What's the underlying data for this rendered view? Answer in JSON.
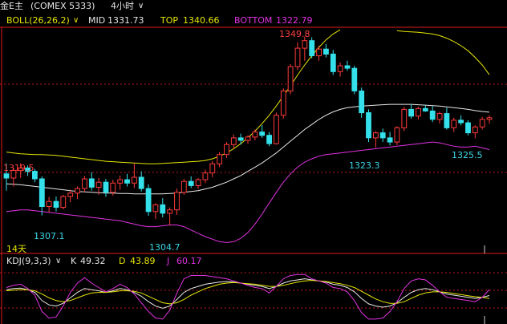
{
  "header": {
    "instrument": "金E主",
    "exchange": "(COMEX 5333)",
    "period": "4小时",
    "period_dropdown_icon": "chevron-down-icon"
  },
  "boll": {
    "name": "BOLL(26,26,2)",
    "mid_label": "MID",
    "mid_value": "1331.73",
    "top_label": "TOP",
    "top_value": "1340.66",
    "bottom_label": "BOTTOM",
    "bottom_value": "1322.79"
  },
  "annotations": {
    "high": "1349.8",
    "left_high": "1319.5",
    "low_1": "1307.1",
    "low_2": "1304.7",
    "low_3": "1323.3",
    "low_4": "1325.5",
    "time_span": "14天"
  },
  "kdj": {
    "name": "KDJ(9,3,3)",
    "k_label": "K",
    "k_value": "49.32",
    "d_label": "D",
    "d_value": "43.89",
    "j_label": "J",
    "j_value": "60.17"
  },
  "colors": {
    "up": "#ff3b3b",
    "down": "#34e1ea",
    "boll_mid": "#e8e8e8",
    "boll_top": "#e6e600",
    "boll_bottom": "#e233e2",
    "grid": "#ff2020"
  },
  "candles": [
    [
      1317.0,
      1319.5,
      1313.0,
      1316.0
    ],
    [
      1316.0,
      1318.5,
      1314.0,
      1317.8
    ],
    [
      1317.8,
      1319.5,
      1316.0,
      1318.4
    ],
    [
      1318.4,
      1319.0,
      1316.5,
      1317.6
    ],
    [
      1317.6,
      1318.2,
      1315.0,
      1315.8
    ],
    [
      1315.8,
      1316.4,
      1307.1,
      1309.2
    ],
    [
      1309.2,
      1311.5,
      1307.8,
      1310.4
    ],
    [
      1310.4,
      1311.6,
      1308.0,
      1309.0
    ],
    [
      1309.0,
      1312.0,
      1308.5,
      1311.6
    ],
    [
      1311.6,
      1313.2,
      1310.2,
      1312.4
    ],
    [
      1312.4,
      1314.0,
      1311.0,
      1313.5
    ],
    [
      1313.5,
      1316.5,
      1312.6,
      1315.8
    ],
    [
      1315.8,
      1317.4,
      1313.0,
      1313.8
    ],
    [
      1313.8,
      1316.0,
      1312.0,
      1315.0
    ],
    [
      1315.0,
      1315.8,
      1311.5,
      1312.6
    ],
    [
      1312.6,
      1315.6,
      1311.8,
      1314.8
    ],
    [
      1314.8,
      1316.6,
      1313.2,
      1315.6
    ],
    [
      1315.6,
      1317.0,
      1314.0,
      1314.8
    ],
    [
      1314.8,
      1319.5,
      1313.6,
      1316.2
    ],
    [
      1316.2,
      1317.6,
      1312.8,
      1313.5
    ],
    [
      1313.5,
      1314.5,
      1307.0,
      1308.0
    ],
    [
      1308.0,
      1310.0,
      1306.2,
      1309.6
    ],
    [
      1309.6,
      1311.2,
      1306.6,
      1307.6
    ],
    [
      1307.6,
      1309.0,
      1304.7,
      1308.4
    ],
    [
      1308.4,
      1313.5,
      1307.2,
      1312.6
    ],
    [
      1312.6,
      1315.8,
      1312.0,
      1315.2
    ],
    [
      1315.2,
      1316.4,
      1313.6,
      1314.2
    ],
    [
      1314.2,
      1316.0,
      1313.4,
      1315.6
    ],
    [
      1315.6,
      1318.0,
      1314.8,
      1317.2
    ],
    [
      1317.2,
      1320.0,
      1316.2,
      1319.4
    ],
    [
      1319.4,
      1322.2,
      1318.6,
      1321.6
    ],
    [
      1321.6,
      1324.6,
      1320.8,
      1324.0
    ],
    [
      1324.0,
      1326.4,
      1323.0,
      1325.6
    ],
    [
      1325.6,
      1326.6,
      1324.0,
      1325.0
    ],
    [
      1325.0,
      1326.2,
      1324.2,
      1325.8
    ],
    [
      1325.8,
      1327.6,
      1325.0,
      1327.0
    ],
    [
      1327.0,
      1328.6,
      1325.6,
      1326.2
    ],
    [
      1326.2,
      1327.0,
      1323.6,
      1324.2
    ],
    [
      1324.2,
      1331.6,
      1324.0,
      1331.0
    ],
    [
      1331.0,
      1337.4,
      1330.2,
      1336.8
    ],
    [
      1336.8,
      1343.2,
      1336.0,
      1342.6
    ],
    [
      1342.6,
      1348.4,
      1341.8,
      1347.0
    ],
    [
      1347.0,
      1349.8,
      1344.0,
      1348.8
    ],
    [
      1348.8,
      1349.6,
      1344.6,
      1345.2
    ],
    [
      1345.2,
      1347.6,
      1344.0,
      1346.8
    ],
    [
      1346.8,
      1348.0,
      1344.8,
      1345.6
    ],
    [
      1345.6,
      1346.6,
      1340.6,
      1341.4
    ],
    [
      1341.4,
      1343.6,
      1340.2,
      1342.8
    ],
    [
      1342.8,
      1344.0,
      1341.6,
      1342.2
    ],
    [
      1342.2,
      1342.8,
      1336.0,
      1336.8
    ],
    [
      1336.8,
      1337.6,
      1330.4,
      1331.6
    ],
    [
      1331.6,
      1332.4,
      1324.6,
      1325.6
    ],
    [
      1325.6,
      1327.2,
      1323.3,
      1326.8
    ],
    [
      1326.8,
      1327.8,
      1324.6,
      1325.6
    ],
    [
      1325.6,
      1327.0,
      1323.8,
      1324.6
    ],
    [
      1324.6,
      1328.4,
      1323.9,
      1328.0
    ],
    [
      1328.0,
      1333.0,
      1327.2,
      1332.4
    ],
    [
      1332.4,
      1333.6,
      1330.2,
      1330.8
    ],
    [
      1330.8,
      1333.0,
      1330.0,
      1332.6
    ],
    [
      1332.6,
      1333.4,
      1331.8,
      1332.0
    ],
    [
      1332.0,
      1333.2,
      1329.4,
      1330.0
    ],
    [
      1330.0,
      1331.8,
      1329.0,
      1331.4
    ],
    [
      1331.4,
      1332.8,
      1327.6,
      1328.0
    ],
    [
      1328.0,
      1330.4,
      1327.0,
      1329.8
    ],
    [
      1329.8,
      1331.0,
      1328.6,
      1329.2
    ],
    [
      1329.2,
      1329.8,
      1326.2,
      1326.8
    ],
    [
      1326.8,
      1328.6,
      1325.5,
      1328.2
    ],
    [
      1328.2,
      1330.6,
      1327.6,
      1330.0
    ],
    [
      1330.0,
      1331.0,
      1329.0,
      1330.4
    ]
  ],
  "boll_lines": {
    "top": [
      1322.2,
      1322.0,
      1321.8,
      1321.7,
      1321.6,
      1321.6,
      1321.5,
      1321.4,
      1321.2,
      1321.0,
      1320.8,
      1320.6,
      1320.4,
      1320.2,
      1320.0,
      1319.9,
      1319.8,
      1319.7,
      1319.6,
      1319.5,
      1319.4,
      1319.4,
      1319.5,
      1319.6,
      1319.7,
      1319.8,
      1319.9,
      1320.0,
      1320.2,
      1320.6,
      1321.2,
      1322.0,
      1323.0,
      1324.2,
      1325.6,
      1327.2,
      1329.0,
      1331.0,
      1333.2,
      1335.6,
      1338.0,
      1340.6,
      1343.0,
      1345.2,
      1347.2,
      1349.0,
      1350.4,
      1351.4,
      null,
      null,
      null,
      null,
      null,
      null,
      null,
      1351.2,
      1351.0,
      1350.9,
      1350.8,
      1350.6,
      1350.4,
      1350.0,
      1349.4,
      1348.6,
      1347.6,
      1346.4,
      1344.8,
      1343.0,
      1340.66
    ],
    "mid": [
      1314.6,
      1314.5,
      1314.4,
      1314.2,
      1314.0,
      1313.8,
      1313.6,
      1313.4,
      1313.2,
      1313.0,
      1312.8,
      1312.7,
      1312.6,
      1312.5,
      1312.4,
      1312.4,
      1312.3,
      1312.3,
      1312.2,
      1312.2,
      1312.2,
      1312.2,
      1312.2,
      1312.3,
      1312.4,
      1312.6,
      1312.8,
      1313.0,
      1313.4,
      1313.8,
      1314.4,
      1315.0,
      1315.8,
      1316.6,
      1317.6,
      1318.6,
      1319.6,
      1320.8,
      1322.0,
      1323.4,
      1324.8,
      1326.2,
      1327.6,
      1328.8,
      1330.0,
      1331.0,
      1331.8,
      1332.4,
      1332.8,
      1333.0,
      1333.2,
      1333.3,
      1333.4,
      1333.5,
      1333.6,
      1333.6,
      1333.6,
      1333.6,
      1333.5,
      1333.4,
      1333.3,
      1333.2,
      1333.0,
      1332.8,
      1332.6,
      1332.4,
      1332.1,
      1331.9,
      1331.73
    ],
    "bottom": [
      1308.0,
      1308.2,
      1308.4,
      1308.4,
      1308.2,
      1308.0,
      1307.8,
      1307.6,
      1307.4,
      1307.2,
      1307.0,
      1306.8,
      1306.6,
      1306.4,
      1306.2,
      1306.0,
      1305.8,
      1305.4,
      1305.0,
      1304.6,
      1304.4,
      1304.4,
      1304.6,
      1304.8,
      1304.8,
      1304.4,
      1303.6,
      1302.8,
      1302.0,
      1301.4,
      1300.8,
      1300.6,
      1300.8,
      1301.6,
      1303.0,
      1305.0,
      1307.4,
      1310.0,
      1312.6,
      1315.0,
      1317.0,
      1318.6,
      1319.8,
      1320.6,
      1321.2,
      1321.6,
      1321.8,
      1322.0,
      1322.2,
      1322.4,
      1322.6,
      1322.8,
      1323.0,
      1323.2,
      1323.4,
      1323.6,
      1323.8,
      1324.0,
      1324.2,
      1324.4,
      1324.6,
      1324.4,
      1324.0,
      1323.6,
      1323.4,
      1323.4,
      1323.6,
      1323.2,
      1322.79
    ]
  },
  "kdj_series": {
    "k": [
      60,
      62,
      63,
      60,
      55,
      40,
      32,
      30,
      35,
      45,
      55,
      62,
      60,
      58,
      55,
      58,
      62,
      60,
      55,
      48,
      38,
      30,
      26,
      30,
      42,
      55,
      62,
      66,
      70,
      72,
      74,
      75,
      74,
      72,
      70,
      68,
      66,
      62,
      66,
      72,
      76,
      78,
      80,
      78,
      76,
      74,
      70,
      68,
      64,
      56,
      44,
      34,
      30,
      28,
      30,
      36,
      46,
      55,
      60,
      62,
      60,
      56,
      52,
      50,
      48,
      46,
      44,
      46,
      49.32
    ],
    "d": [
      58,
      59,
      60,
      60,
      58,
      52,
      45,
      40,
      38,
      40,
      45,
      50,
      54,
      55,
      55,
      56,
      58,
      58,
      57,
      54,
      48,
      42,
      36,
      34,
      36,
      42,
      50,
      56,
      62,
      66,
      70,
      72,
      73,
      72,
      71,
      70,
      68,
      66,
      66,
      68,
      71,
      74,
      76,
      77,
      76,
      75,
      73,
      71,
      68,
      64,
      57,
      50,
      43,
      38,
      35,
      35,
      38,
      44,
      50,
      54,
      56,
      56,
      55,
      53,
      51,
      49,
      47,
      46,
      43.89
    ],
    "j": [
      64,
      68,
      70,
      62,
      50,
      20,
      8,
      10,
      30,
      55,
      72,
      82,
      72,
      64,
      56,
      62,
      70,
      64,
      52,
      36,
      20,
      8,
      6,
      22,
      54,
      80,
      86,
      86,
      86,
      84,
      82,
      80,
      76,
      72,
      68,
      64,
      62,
      54,
      66,
      80,
      86,
      88,
      88,
      80,
      76,
      72,
      64,
      62,
      56,
      40,
      18,
      6,
      6,
      8,
      20,
      38,
      62,
      76,
      80,
      78,
      68,
      56,
      46,
      44,
      42,
      40,
      38,
      46,
      60.17
    ]
  }
}
